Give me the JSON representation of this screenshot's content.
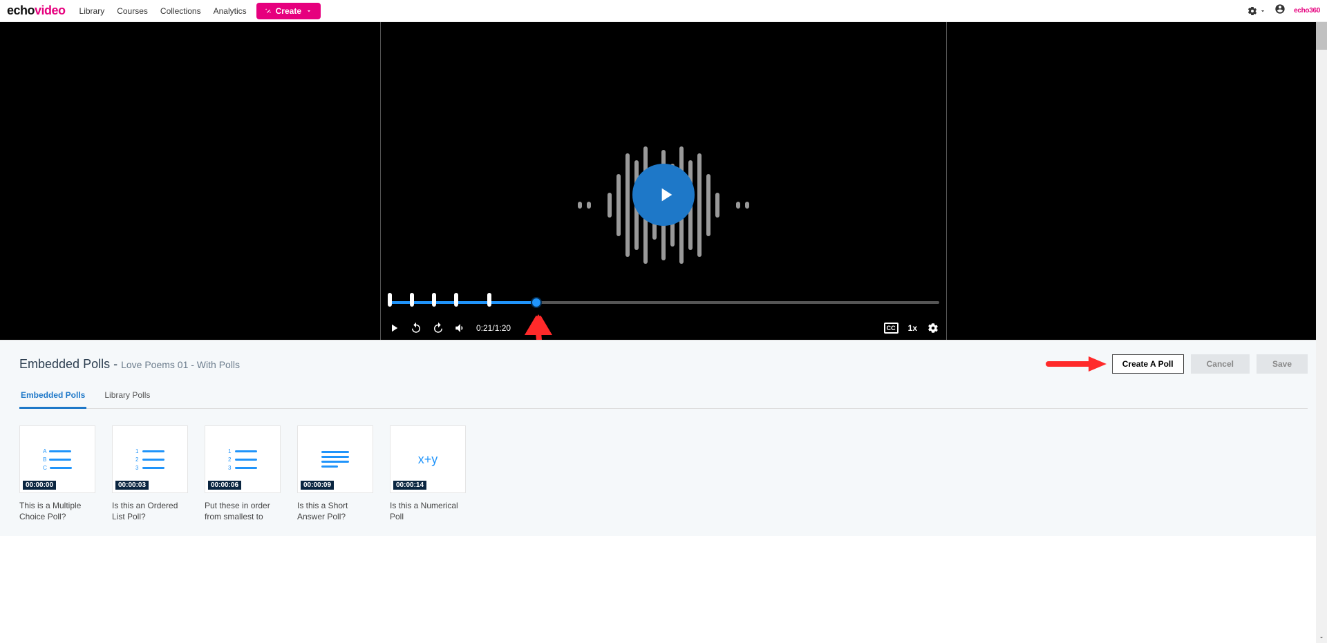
{
  "header": {
    "logo": {
      "part1": "echo",
      "part2": "video"
    },
    "nav": [
      "Library",
      "Courses",
      "Collections",
      "Analytics"
    ],
    "create_label": "Create",
    "brand_small": "echo360"
  },
  "player": {
    "current_time": "0:21",
    "duration": "1:20",
    "time_display": "0:21/1:20",
    "progress_percent": 27,
    "speed": "1x",
    "cc": "CC",
    "marker_percents": [
      0,
      4,
      8,
      12,
      18
    ]
  },
  "polls_section": {
    "title_prefix": "Embedded Polls - ",
    "title_media": "Love Poems 01 - With Polls",
    "actions": {
      "create": "Create A Poll",
      "cancel": "Cancel",
      "save": "Save"
    },
    "tabs": [
      "Embedded Polls",
      "Library Polls"
    ],
    "active_tab": 0,
    "cards": [
      {
        "time": "00:00:00",
        "label": "This is a Multiple Choice Poll?",
        "type": "mc"
      },
      {
        "time": "00:00:03",
        "label": "Is this an Ordered List Poll?",
        "type": "ord"
      },
      {
        "time": "00:00:06",
        "label": "Put these in order from smallest to",
        "type": "ord"
      },
      {
        "time": "00:00:09",
        "label": "Is this a Short Answer Poll?",
        "type": "sa"
      },
      {
        "time": "00:00:14",
        "label": "Is this a Numerical Poll",
        "type": "num"
      }
    ]
  }
}
